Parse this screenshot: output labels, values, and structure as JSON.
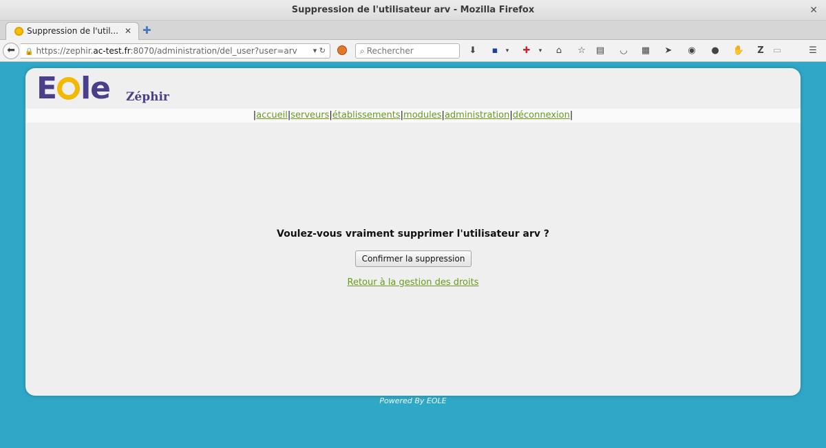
{
  "window": {
    "title": "Suppression de l'utilisateur arv - Mozilla Firefox",
    "close_glyph": "✕"
  },
  "tab": {
    "title": "Suppression de l'util...",
    "close_glyph": "✕"
  },
  "newtab": {
    "glyph": "✚"
  },
  "urlbar": {
    "prefix": "https://zephir.",
    "domain": "ac-test.fr",
    "suffix": ":8070/administration/del_user?user=arv"
  },
  "search": {
    "placeholder": "Rechercher"
  },
  "toolbar_icons": [
    "download-icon",
    "save-icon",
    "addon-icon",
    "home-icon",
    "bookmark-star-icon",
    "reading-list-icon",
    "pocket-icon",
    "apps-grid-icon",
    "send-icon",
    "pause-icon",
    "chat-icon",
    "hand-icon",
    "zotero-icon",
    "page-icon",
    "menu-icon"
  ],
  "header": {
    "app_name": "Zéphir"
  },
  "menu": {
    "items": [
      "accueil",
      "serveurs",
      "établissements",
      "modules",
      "administration",
      "déconnexion"
    ],
    "separator": "|"
  },
  "content": {
    "question": "Voulez-vous vraiment supprimer l'utilisateur arv ?",
    "confirm_button": "Confirmer la suppression",
    "back_link": "Retour à la gestion des droits"
  },
  "footer": {
    "text": "Powered By EOLE"
  },
  "colors": {
    "background": "#2fa8c7",
    "link": "#6a9a1d",
    "logo": "#4a3f8a",
    "logo_accent": "#f3b800"
  }
}
